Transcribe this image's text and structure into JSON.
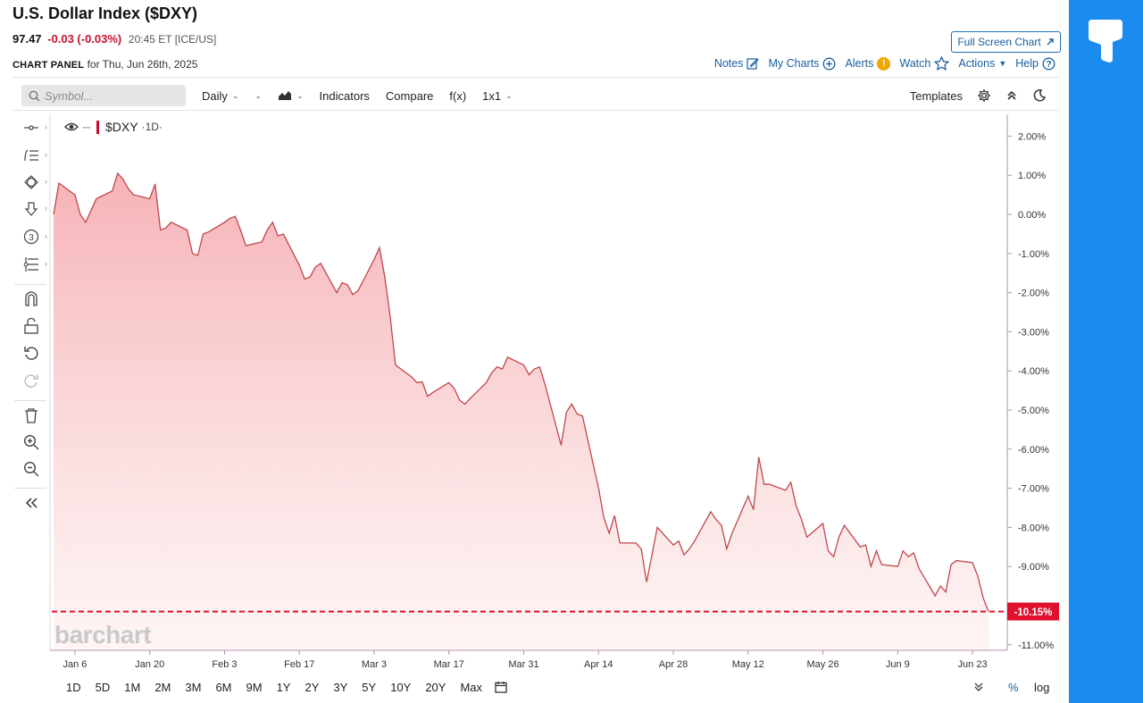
{
  "header": {
    "title": "U.S. Dollar Index ($DXY)",
    "last": "97.47",
    "change": "-0.03 (-0.03%)",
    "time": "20:45 ET [ICE/US]",
    "panel_label": "CHART PANEL",
    "panel_date": "for Thu, Jun 26th, 2025"
  },
  "actions": {
    "full_screen": "Full Screen Chart",
    "notes": "Notes",
    "my_charts": "My Charts",
    "alerts": "Alerts",
    "alerts_badge": "!",
    "watch": "Watch",
    "actions": "Actions",
    "help": "Help"
  },
  "toolbar": {
    "symbol_placeholder": "Symbol...",
    "interval": "Daily",
    "indicators": "Indicators",
    "compare": "Compare",
    "fx": "f(x)",
    "layout": "1x1",
    "templates": "Templates"
  },
  "legend": {
    "ticker": "$DXY",
    "resolution": "·1D·"
  },
  "watermark": "barchart",
  "range_buttons": [
    "1D",
    "5D",
    "1M",
    "2M",
    "3M",
    "6M",
    "9M",
    "1Y",
    "2Y",
    "3Y",
    "5Y",
    "10Y",
    "20Y",
    "Max"
  ],
  "scale": {
    "percent": "%",
    "log": "log"
  },
  "colors": {
    "line": "#c0464c",
    "fill": "#f6b5b9",
    "last_marker": "#e0102f",
    "accent": "#1a8cf0"
  },
  "chart_data": {
    "type": "area",
    "title": "",
    "xlabel": "",
    "ylabel": "",
    "y_unit": "%",
    "ylim": [
      -11.4,
      2.5
    ],
    "y_ticks": [
      2,
      1,
      0,
      -1,
      -2,
      -3,
      -4,
      -5,
      -6,
      -7,
      -8,
      -9,
      -11
    ],
    "y_tick_labels": [
      "2.00%",
      "1.00%",
      "0.00%",
      "-1.00%",
      "-2.00%",
      "-3.00%",
      "-4.00%",
      "-5.00%",
      "-6.00%",
      "-7.00%",
      "-8.00%",
      "-9.00%",
      "-11.00%"
    ],
    "x_tick_labels": [
      "Jan 6",
      "Jan 20",
      "Feb 3",
      "Feb 17",
      "Mar 3",
      "Mar 17",
      "Mar 31",
      "Apr 14",
      "Apr 28",
      "May 12",
      "May 26",
      "Jun 9",
      "Jun 23"
    ],
    "x_tick_dates": [
      "2025-01-06",
      "2025-01-20",
      "2025-02-03",
      "2025-02-17",
      "2025-03-03",
      "2025-03-17",
      "2025-03-31",
      "2025-04-14",
      "2025-04-28",
      "2025-05-12",
      "2025-05-26",
      "2025-06-09",
      "2025-06-23"
    ],
    "last_value": -10.15,
    "last_label": "-10.15%",
    "grid": false,
    "series": [
      {
        "values": [
          [
            "2025-01-02",
            0.0
          ],
          [
            "2025-01-03",
            0.8
          ],
          [
            "2025-01-06",
            0.5
          ],
          [
            "2025-01-07",
            0.0
          ],
          [
            "2025-01-08",
            -0.2
          ],
          [
            "2025-01-09",
            0.1
          ],
          [
            "2025-01-10",
            0.4
          ],
          [
            "2025-01-13",
            0.6
          ],
          [
            "2025-01-14",
            1.05
          ],
          [
            "2025-01-15",
            0.9
          ],
          [
            "2025-01-16",
            0.65
          ],
          [
            "2025-01-17",
            0.5
          ],
          [
            "2025-01-20",
            0.4
          ],
          [
            "2025-01-21",
            0.78
          ],
          [
            "2025-01-22",
            -0.4
          ],
          [
            "2025-01-23",
            -0.35
          ],
          [
            "2025-01-24",
            -0.2
          ],
          [
            "2025-01-27",
            -0.4
          ],
          [
            "2025-01-28",
            -1.0
          ],
          [
            "2025-01-29",
            -1.05
          ],
          [
            "2025-01-30",
            -0.5
          ],
          [
            "2025-01-31",
            -0.45
          ],
          [
            "2025-02-03",
            -0.2
          ],
          [
            "2025-02-04",
            -0.1
          ],
          [
            "2025-02-05",
            -0.05
          ],
          [
            "2025-02-06",
            -0.4
          ],
          [
            "2025-02-07",
            -0.8
          ],
          [
            "2025-02-10",
            -0.7
          ],
          [
            "2025-02-11",
            -0.4
          ],
          [
            "2025-02-12",
            -0.2
          ],
          [
            "2025-02-13",
            -0.55
          ],
          [
            "2025-02-14",
            -0.5
          ],
          [
            "2025-02-17",
            -1.3
          ],
          [
            "2025-02-18",
            -1.65
          ],
          [
            "2025-02-19",
            -1.6
          ],
          [
            "2025-02-20",
            -1.35
          ],
          [
            "2025-02-21",
            -1.25
          ],
          [
            "2025-02-24",
            -2.0
          ],
          [
            "2025-02-25",
            -1.75
          ],
          [
            "2025-02-26",
            -1.8
          ],
          [
            "2025-02-27",
            -2.05
          ],
          [
            "2025-02-28",
            -1.95
          ],
          [
            "2025-03-03",
            -1.15
          ],
          [
            "2025-03-04",
            -0.85
          ],
          [
            "2025-03-05",
            -1.6
          ],
          [
            "2025-03-06",
            -2.6
          ],
          [
            "2025-03-07",
            -3.85
          ],
          [
            "2025-03-10",
            -4.15
          ],
          [
            "2025-03-11",
            -4.3
          ],
          [
            "2025-03-12",
            -4.28
          ],
          [
            "2025-03-13",
            -4.65
          ],
          [
            "2025-03-14",
            -4.55
          ],
          [
            "2025-03-17",
            -4.3
          ],
          [
            "2025-03-18",
            -4.45
          ],
          [
            "2025-03-19",
            -4.75
          ],
          [
            "2025-03-20",
            -4.85
          ],
          [
            "2025-03-21",
            -4.7
          ],
          [
            "2025-03-24",
            -4.3
          ],
          [
            "2025-03-25",
            -4.05
          ],
          [
            "2025-03-26",
            -3.9
          ],
          [
            "2025-03-27",
            -3.95
          ],
          [
            "2025-03-28",
            -3.65
          ],
          [
            "2025-03-31",
            -3.85
          ],
          [
            "2025-04-01",
            -4.1
          ],
          [
            "2025-04-02",
            -3.95
          ],
          [
            "2025-04-03",
            -3.9
          ],
          [
            "2025-04-04",
            -4.35
          ],
          [
            "2025-04-07",
            -5.9
          ],
          [
            "2025-04-08",
            -5.05
          ],
          [
            "2025-04-09",
            -4.85
          ],
          [
            "2025-04-10",
            -5.1
          ],
          [
            "2025-04-11",
            -5.15
          ],
          [
            "2025-04-14",
            -7.0
          ],
          [
            "2025-04-15",
            -7.75
          ],
          [
            "2025-04-16",
            -8.15
          ],
          [
            "2025-04-17",
            -7.7
          ],
          [
            "2025-04-18",
            -8.4
          ],
          [
            "2025-04-21",
            -8.4
          ],
          [
            "2025-04-22",
            -8.55
          ],
          [
            "2025-04-23",
            -9.4
          ],
          [
            "2025-04-24",
            -8.7
          ],
          [
            "2025-04-25",
            -8.0
          ],
          [
            "2025-04-28",
            -8.45
          ],
          [
            "2025-04-29",
            -8.35
          ],
          [
            "2025-04-30",
            -8.7
          ],
          [
            "2025-05-01",
            -8.55
          ],
          [
            "2025-05-02",
            -8.35
          ],
          [
            "2025-05-05",
            -7.6
          ],
          [
            "2025-05-06",
            -7.8
          ],
          [
            "2025-05-07",
            -7.95
          ],
          [
            "2025-05-08",
            -8.55
          ],
          [
            "2025-05-09",
            -8.15
          ],
          [
            "2025-05-12",
            -7.2
          ],
          [
            "2025-05-13",
            -7.55
          ],
          [
            "2025-05-14",
            -6.2
          ],
          [
            "2025-05-15",
            -6.9
          ],
          [
            "2025-05-16",
            -6.9
          ],
          [
            "2025-05-19",
            -7.05
          ],
          [
            "2025-05-20",
            -6.85
          ],
          [
            "2025-05-21",
            -7.45
          ],
          [
            "2025-05-22",
            -7.8
          ],
          [
            "2025-05-23",
            -8.25
          ],
          [
            "2025-05-26",
            -7.9
          ],
          [
            "2025-05-27",
            -8.6
          ],
          [
            "2025-05-28",
            -8.75
          ],
          [
            "2025-05-29",
            -8.25
          ],
          [
            "2025-05-30",
            -7.95
          ],
          [
            "2025-06-02",
            -8.5
          ],
          [
            "2025-06-03",
            -8.45
          ],
          [
            "2025-06-04",
            -9.0
          ],
          [
            "2025-06-05",
            -8.6
          ],
          [
            "2025-06-06",
            -8.95
          ],
          [
            "2025-06-09",
            -9.0
          ],
          [
            "2025-06-10",
            -8.6
          ],
          [
            "2025-06-11",
            -8.75
          ],
          [
            "2025-06-12",
            -8.65
          ],
          [
            "2025-06-13",
            -9.05
          ],
          [
            "2025-06-16",
            -9.75
          ],
          [
            "2025-06-17",
            -9.5
          ],
          [
            "2025-06-18",
            -9.65
          ],
          [
            "2025-06-19",
            -8.95
          ],
          [
            "2025-06-20",
            -8.85
          ],
          [
            "2025-06-23",
            -8.9
          ],
          [
            "2025-06-24",
            -9.25
          ],
          [
            "2025-06-25",
            -9.8
          ],
          [
            "2025-06-26",
            -10.15
          ]
        ]
      }
    ]
  }
}
